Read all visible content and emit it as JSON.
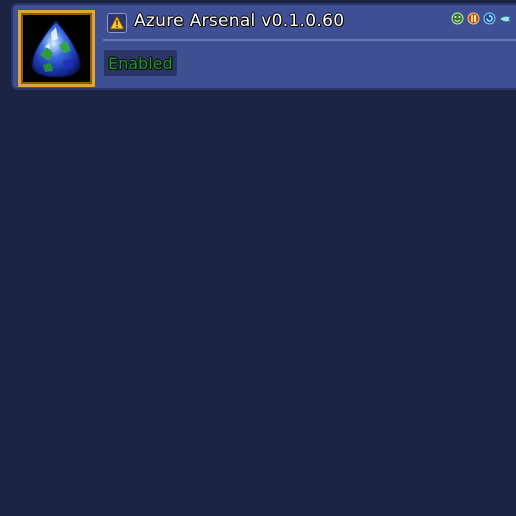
{
  "mod": {
    "title": "Azure Arsenal v0.1.0.60",
    "status": "Enabled",
    "icon": "azure-gem-icon",
    "warning_icon": "warning-icon"
  },
  "side_icons": [
    "smile-icon",
    "client-server-icon",
    "refresh-icon",
    "wing-icon"
  ],
  "colors": {
    "background": "#1b2342",
    "panel": "#3f4f94",
    "icon_frame": "#e2a33a",
    "enabled_text": "#1f9e2a",
    "toggle_bg": "#2a3465"
  }
}
